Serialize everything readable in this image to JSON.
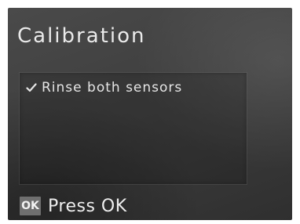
{
  "screen": {
    "title": "Calibration"
  },
  "steps": [
    {
      "label": "Rinse both sensors",
      "status_icon": "check-icon"
    }
  ],
  "footer": {
    "key_label": "OK",
    "prompt": "Press OK"
  },
  "colors": {
    "background": "#3f3f3f",
    "text": "#eaeaea",
    "key_background": "#6f6f6f"
  }
}
